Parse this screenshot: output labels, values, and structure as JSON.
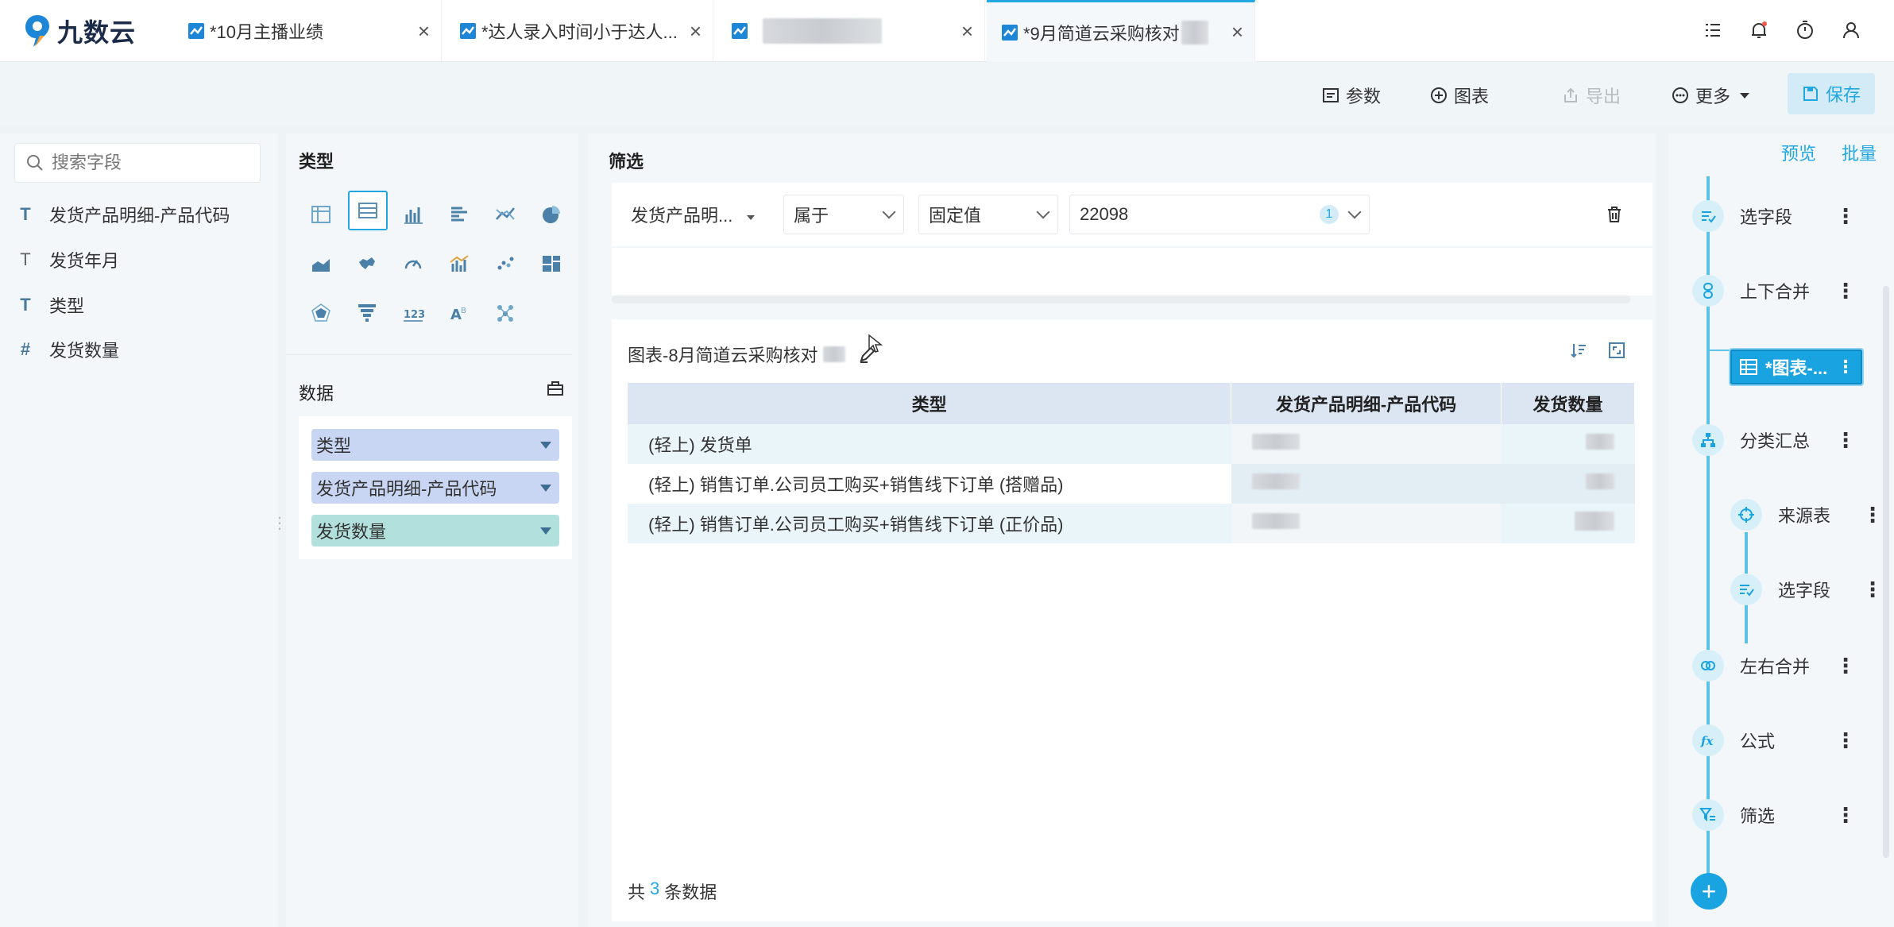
{
  "brand": {
    "name": "九数云"
  },
  "tabs": [
    {
      "label": "*10月主播业绩"
    },
    {
      "label": "*达人录入时间小于达人..."
    },
    {
      "label": ""
    },
    {
      "label": "*9月简道云采购核对"
    }
  ],
  "toolbar": {
    "params": "参数",
    "chart": "图表",
    "export": "导出",
    "more": "更多",
    "save": "保存"
  },
  "fields": {
    "search_placeholder": "搜索字段",
    "items": [
      {
        "label": "发货产品明细-产品代码",
        "icon": "T"
      },
      {
        "label": "发货年月",
        "icon": "T"
      },
      {
        "label": "类型",
        "icon": "T"
      },
      {
        "label": "发货数量",
        "icon": "#"
      }
    ]
  },
  "type_section": {
    "title": "类型"
  },
  "data_section": {
    "title": "数据",
    "pills": [
      {
        "label": "类型",
        "color": "#c9d6f3"
      },
      {
        "label": "发货产品明细-产品代码",
        "color": "#c9d6f3"
      },
      {
        "label": "发货数量",
        "color": "#b2e0dc"
      }
    ]
  },
  "filter": {
    "title": "筛选",
    "field": "发货产品明...",
    "operator": "属于",
    "mode": "固定值",
    "value": "22098",
    "count": "1"
  },
  "chart": {
    "title": "图表-8月简道云采购核对",
    "columns": [
      "类型",
      "发货产品明细-产品代码",
      "发货数量"
    ],
    "rows": [
      [
        "(轻上) 发货单",
        "",
        ""
      ],
      [
        "(轻上) 销售订单.公司员工购买+销售线下订单 (搭赠品)",
        "",
        ""
      ],
      [
        "(轻上) 销售订单.公司员工购买+销售线下订单 (正价品)",
        "",
        ""
      ]
    ],
    "footer_prefix": "共",
    "footer_count": "3",
    "footer_suffix": "条数据"
  },
  "right": {
    "preview": "预览",
    "batch": "批量",
    "nodes": [
      {
        "label": "选字段",
        "icon": "select-field-icon"
      },
      {
        "label": "上下合并",
        "icon": "vertical-merge-icon"
      },
      {
        "label": "*图表-...",
        "icon": "table-icon"
      },
      {
        "label": "分类汇总",
        "icon": "group-summary-icon"
      },
      {
        "label": "来源表",
        "icon": "source-table-icon"
      },
      {
        "label": "选字段",
        "icon": "select-field-icon"
      },
      {
        "label": "左右合并",
        "icon": "horizontal-merge-icon"
      },
      {
        "label": "公式",
        "icon": "formula-icon"
      },
      {
        "label": "筛选",
        "icon": "filter-icon"
      }
    ]
  },
  "colors": {
    "accent": "#1aa3e1",
    "header_bg": "#dce6f3"
  }
}
